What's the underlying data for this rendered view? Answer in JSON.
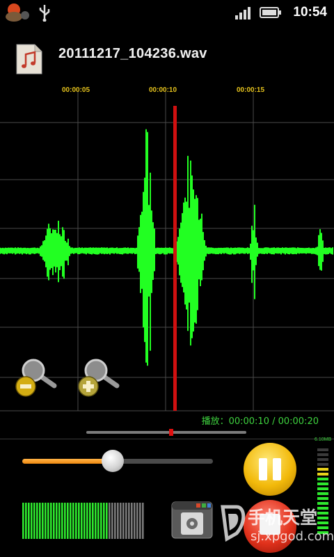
{
  "status_bar": {
    "time": "10:54",
    "icons": [
      "app-notification-icon",
      "usb-icon",
      "signal-icon",
      "battery-icon"
    ]
  },
  "file": {
    "name": "20111217_104236.wav",
    "icon": "music-file-icon"
  },
  "timeline": {
    "ticks": [
      "00:00:05",
      "00:00:10",
      "00:00:15"
    ]
  },
  "playback": {
    "status": "播放：00:00:10 / 00:00:20",
    "position_fraction": 0.5
  },
  "volume": {
    "level_fraction": 0.47
  },
  "controls": {
    "zoom_out": "zoom-out-icon",
    "zoom_in": "zoom-in-icon",
    "pause": "pause-icon",
    "stop": "stop-icon",
    "save": "save-file-icon"
  },
  "vu_meter": {
    "label": "6.10MB"
  },
  "colors": {
    "waveform": "#22ff22",
    "playhead": "#d01010",
    "tick_label": "#e5c21d",
    "status_text": "#3fd43f",
    "slider_fill": "#f39a1e"
  },
  "watermark": {
    "text": "手机天堂",
    "url": "sj.xpgod.com"
  }
}
